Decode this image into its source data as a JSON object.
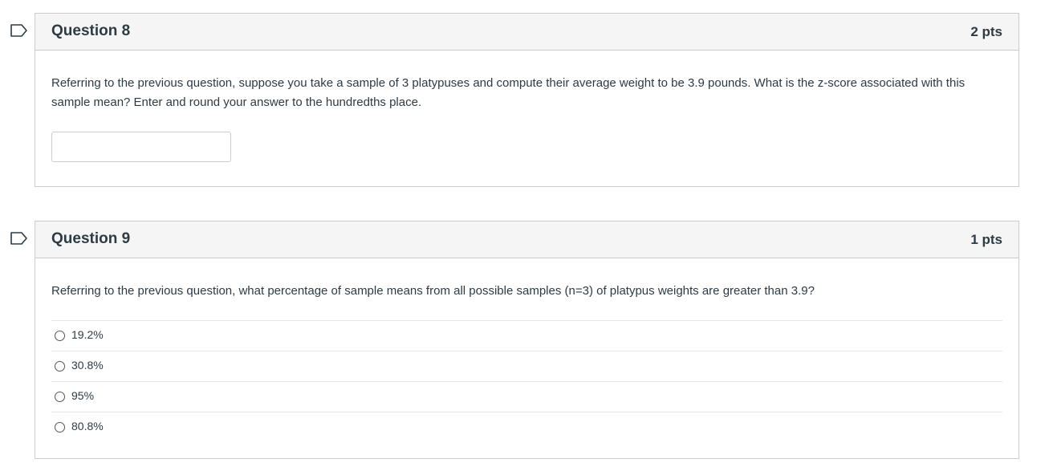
{
  "questions": [
    {
      "title": "Question 8",
      "points": "2 pts",
      "text": "Referring to the previous question, suppose you take a sample of 3 platypuses and compute their average weight to be 3.9 pounds. What is the z-score associated with this sample mean? Enter and round your answer to the hundredths place.",
      "answer_value": ""
    },
    {
      "title": "Question 9",
      "points": "1 pts",
      "text": "Referring to the previous question, what percentage of sample means from all possible samples (n=3) of platypus weights are greater than 3.9?",
      "options": [
        "19.2%",
        "30.8%",
        "95%",
        "80.8%"
      ]
    }
  ],
  "icons": {
    "flag": "flag-icon"
  },
  "colors": {
    "border": "#c7cdd1",
    "header_bg": "#f5f5f5",
    "text": "#2d3b45"
  }
}
